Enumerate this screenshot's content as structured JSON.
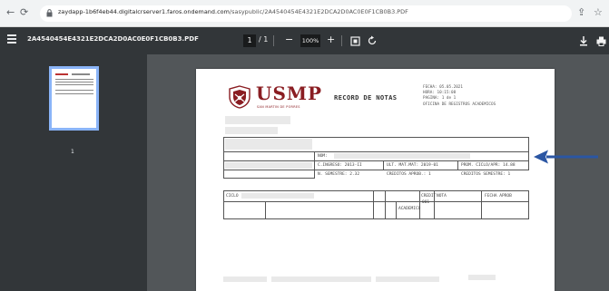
{
  "browser": {
    "url_host": "zaydapp-1b6f4eb44.digitalcrserver1.faros.ondemand.com",
    "url_path": "/sasypublic/2A4540454E4321E2DCA2D0AC0E0F1CB0B3.PDF"
  },
  "toolbar": {
    "doc_title": "2A4540454E4321E2DCA2D0AC0E0F1CB0B3.PDF",
    "page_current": "1",
    "page_sep": "/ 1",
    "zoom_minus": "−",
    "zoom_value": "100%",
    "zoom_plus": "+"
  },
  "sidebar": {
    "thumb_page_number": "1"
  },
  "document": {
    "logo_text": "USMP",
    "logo_sub": "SAN MARTIN DE PORRES",
    "heading": "RECORD DE NOTAS",
    "meta": [
      "FECHA:    05.05.2021",
      "HORA:     10:15:08",
      "PAGINA:   1 de 1",
      "OFICINA DE REGISTROS ACADEMICOS"
    ],
    "record_fields": {
      "nombre": "NOM:",
      "ciclo_ingreso": "C.INGRESO: 2013-II",
      "ult_mat": "ULT. MAT.MAT: 2019-01",
      "prom_ciclo": "PROM. CICLO/APR: 14.88",
      "n_semestre": "N. SEMESTRE: 2.32",
      "creditos_aprob": "CREDITOS APROB.: 1",
      "creditos_semestre": "CREDITOS SEMESTRE: 1"
    },
    "grid": {
      "h_ciclo": "CICLO",
      "h_creditos": "CREDIT",
      "h_nota": "NOTA",
      "h_fecha": "FECHA APROB",
      "r1_tipo": "ACADEMICO",
      "r1_val": "001"
    }
  }
}
